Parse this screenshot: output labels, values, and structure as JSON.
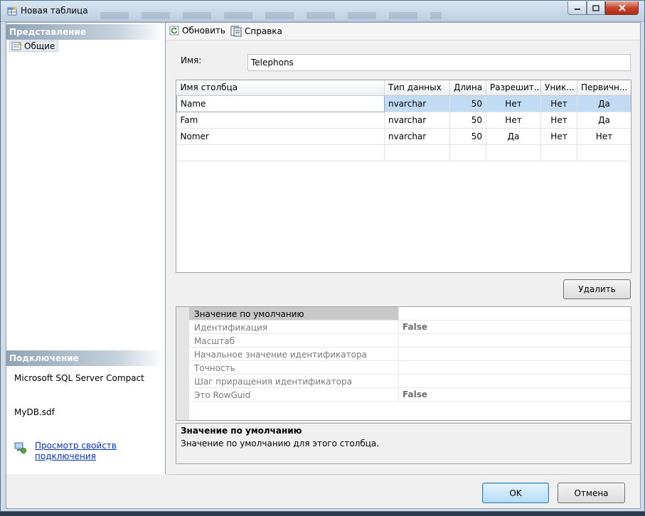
{
  "window": {
    "title": "Новая таблица"
  },
  "sidebar": {
    "view_header": "Представление",
    "items": [
      {
        "label": "Общие"
      }
    ],
    "connection_header": "Подключение",
    "server": "Microsoft SQL Server Compact",
    "database": "MyDB.sdf",
    "link": "Просмотр свойств подключения"
  },
  "toolbar": {
    "refresh_label": "Обновить",
    "help_label": "Справка"
  },
  "form": {
    "name_label": "Имя:",
    "name_value": "Telephons"
  },
  "grid": {
    "columns": [
      "Имя столбца",
      "Тип данных",
      "Длина",
      "Разрешит...",
      "Уник...",
      "Первичн..."
    ],
    "rows": [
      [
        "Name",
        "nvarchar",
        "50",
        "Нет",
        "Нет",
        "Да"
      ],
      [
        "Fam",
        "nvarchar",
        "50",
        "Нет",
        "Нет",
        "Да"
      ],
      [
        "Nomer",
        "nvarchar",
        "50",
        "Да",
        "Нет",
        "Нет"
      ]
    ]
  },
  "delete_label": "Удалить",
  "properties": [
    {
      "name": "Значение по умолчанию",
      "value": ""
    },
    {
      "name": "Идентификация",
      "value": "False"
    },
    {
      "name": "Масштаб",
      "value": ""
    },
    {
      "name": "Начальное значение идентификатора",
      "value": ""
    },
    {
      "name": "Точность",
      "value": ""
    },
    {
      "name": "Шаг приращения идентификатора",
      "value": ""
    },
    {
      "name": "Это RowGuid",
      "value": "False"
    }
  ],
  "description": {
    "title": "Значение по умолчанию",
    "text": "Значение по умолчанию для этого столбца."
  },
  "buttons": {
    "ok": "OK",
    "cancel": "Отмена"
  },
  "colors": {
    "selection": "#c2dbf5",
    "link": "#0033cc",
    "title_bar": "#bccee1"
  }
}
